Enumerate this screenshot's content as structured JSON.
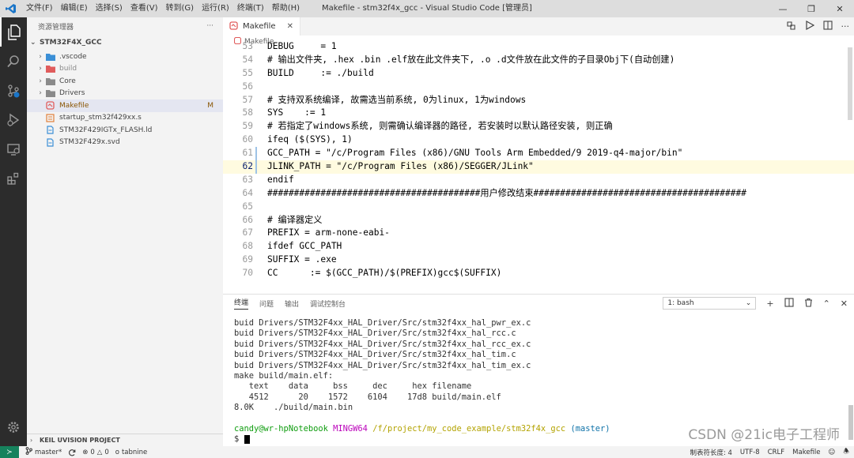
{
  "titlebar": {
    "menu": [
      "文件(F)",
      "编辑(E)",
      "选择(S)",
      "查看(V)",
      "转到(G)",
      "运行(R)",
      "终端(T)",
      "帮助(H)"
    ],
    "title": "Makefile - stm32f4x_gcc - Visual Studio Code [管理员]"
  },
  "sidebar": {
    "header": "资源管理器",
    "more": "···",
    "project": "STM32F4X_GCC",
    "items": [
      {
        "label": ".vscode",
        "type": "folder"
      },
      {
        "label": "build",
        "type": "folder"
      },
      {
        "label": "Core",
        "type": "folder"
      },
      {
        "label": "Drivers",
        "type": "folder"
      },
      {
        "label": "Makefile",
        "type": "makefile",
        "badge": "M"
      },
      {
        "label": "startup_stm32f429xx.s",
        "type": "asm"
      },
      {
        "label": "STM32F429IGTx_FLASH.ld",
        "type": "file"
      },
      {
        "label": "STM32F429x.svd",
        "type": "file"
      }
    ],
    "bottom_section": "KEIL UVISION PROJECT"
  },
  "editor": {
    "tab_label": "Makefile",
    "breadcrumb": "Makefile",
    "lines": [
      {
        "n": "53",
        "t": "DEBUG     = 1"
      },
      {
        "n": "54",
        "t": "# 输出文件夹, .hex .bin .elf放在此文件夹下, .o .d文件放在此文件的子目录Obj下(自动创建)"
      },
      {
        "n": "55",
        "t": "BUILD     := ./build"
      },
      {
        "n": "56",
        "t": ""
      },
      {
        "n": "57",
        "t": "# 支持双系统编译, 故需选当前系统, 0为linux, 1为windows"
      },
      {
        "n": "58",
        "t": "SYS    := 1"
      },
      {
        "n": "59",
        "t": "# 若指定了windows系统, 则需确认编译器的路径, 若安装时以默认路径安装, 则正确"
      },
      {
        "n": "60",
        "t": "ifeq ($(SYS), 1)"
      },
      {
        "n": "61",
        "t": "GCC_PATH = \"/c/Program Files (x86)/GNU Tools Arm Embedded/9 2019-q4-major/bin\""
      },
      {
        "n": "62",
        "t": "JLINK_PATH = \"/c/Program Files (x86)/SEGGER/JLink\""
      },
      {
        "n": "63",
        "t": "endif"
      },
      {
        "n": "64",
        "t": "########################################用户修改结束########################################"
      },
      {
        "n": "65",
        "t": ""
      },
      {
        "n": "66",
        "t": "# 编译器定义"
      },
      {
        "n": "67",
        "t": "PREFIX = arm-none-eabi-"
      },
      {
        "n": "68",
        "t": "ifdef GCC_PATH"
      },
      {
        "n": "69",
        "t": "SUFFIX = .exe"
      },
      {
        "n": "70",
        "t": "CC      := $(GCC_PATH)/$(PREFIX)gcc$(SUFFIX)"
      }
    ]
  },
  "panel": {
    "tabs": [
      "终端",
      "问题",
      "输出",
      "调试控制台"
    ],
    "terminal_select": "1: bash",
    "terminal_lines": [
      "buid Drivers/STM32F4xx_HAL_Driver/Src/stm32f4xx_hal_pwr_ex.c",
      "buid Drivers/STM32F4xx_HAL_Driver/Src/stm32f4xx_hal_rcc.c",
      "buid Drivers/STM32F4xx_HAL_Driver/Src/stm32f4xx_hal_rcc_ex.c",
      "buid Drivers/STM32F4xx_HAL_Driver/Src/stm32f4xx_hal_tim.c",
      "buid Drivers/STM32F4xx_HAL_Driver/Src/stm32f4xx_hal_tim_ex.c",
      "make build/main.elf:",
      "   text    data     bss     dec     hex filename",
      "   4512      20    1572    6104    17d8 build/main.elf",
      "8.0K    ./build/main.bin",
      ""
    ],
    "prompt": {
      "user": "candy@wr-hpNotebook",
      "env": "MINGW64",
      "path": "/f/project/my_code_example/stm32f4x_gcc",
      "branch": "(master)",
      "symbol": "$"
    },
    "watermark": "CSDN @21ic电子工程师"
  },
  "statusbar": {
    "branch": "master*",
    "errors": "0",
    "warnings": "0",
    "tabnine": "tabnine",
    "indent": "制表符长度: 4",
    "encoding": "UTF-8",
    "eol": "CRLF",
    "language": "Makefile"
  },
  "colors": {
    "activity_bar": "#2c2c2c",
    "sidebar_bg": "#f3f3f3",
    "selected_item": "#e4e6f1",
    "comment": "#008000",
    "keyword": "#0000ff",
    "variable": "#800000",
    "string": "#a31515",
    "terminal_green": "#0f9d0f",
    "terminal_magenta": "#bc05bc",
    "terminal_yellow": "#b3a300",
    "terminal_cyan": "#0e72a8",
    "remote_green": "#16825d"
  }
}
